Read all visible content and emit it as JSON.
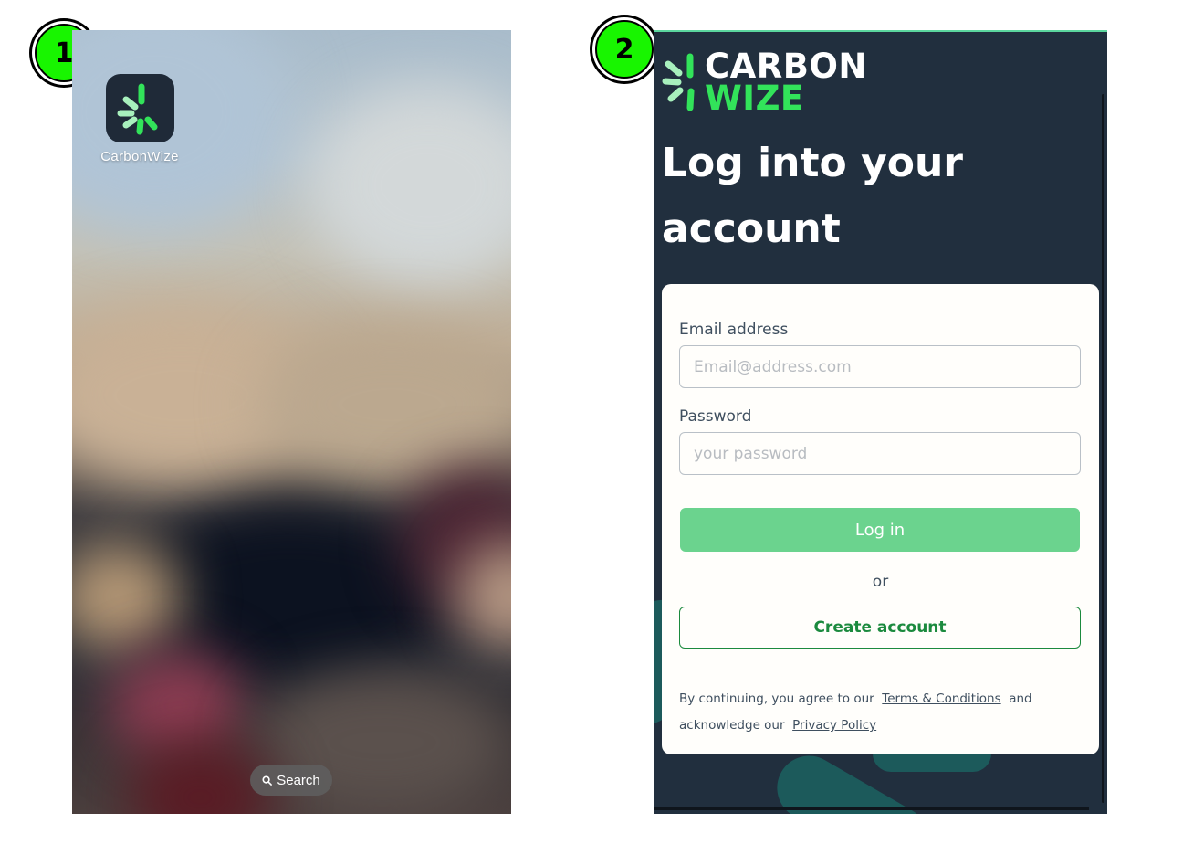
{
  "steps": [
    {
      "number": "1"
    },
    {
      "number": "2"
    }
  ],
  "home_screen": {
    "app_icon": {
      "label": "CarbonWize",
      "icon": "carbonwize-logo-icon"
    },
    "search": {
      "label": "Search",
      "icon": "search-icon"
    }
  },
  "login_screen": {
    "brand": {
      "line1": "CARBON",
      "line2": "WIZE",
      "logo": "carbonwize-logo-icon"
    },
    "title": "Log into your account",
    "email": {
      "label": "Email address",
      "placeholder": "Email@address.com",
      "value": ""
    },
    "password": {
      "label": "Password",
      "placeholder": "your password",
      "value": ""
    },
    "login_button": "Log in",
    "or_text": "or",
    "create_account_button": "Create account",
    "terms": {
      "prefix": "By continuing, you agree to our",
      "terms_link": "Terms & Conditions",
      "middle": "and acknowledge our",
      "privacy_link": "Privacy Policy"
    }
  },
  "colors": {
    "badge_green": "#18f500",
    "app_bg": "#212f3e",
    "brand_green": "#32e35a",
    "login_button": "#6bd38e",
    "create_account_border": "#1b8a3e",
    "card_bg": "#fffefb"
  }
}
